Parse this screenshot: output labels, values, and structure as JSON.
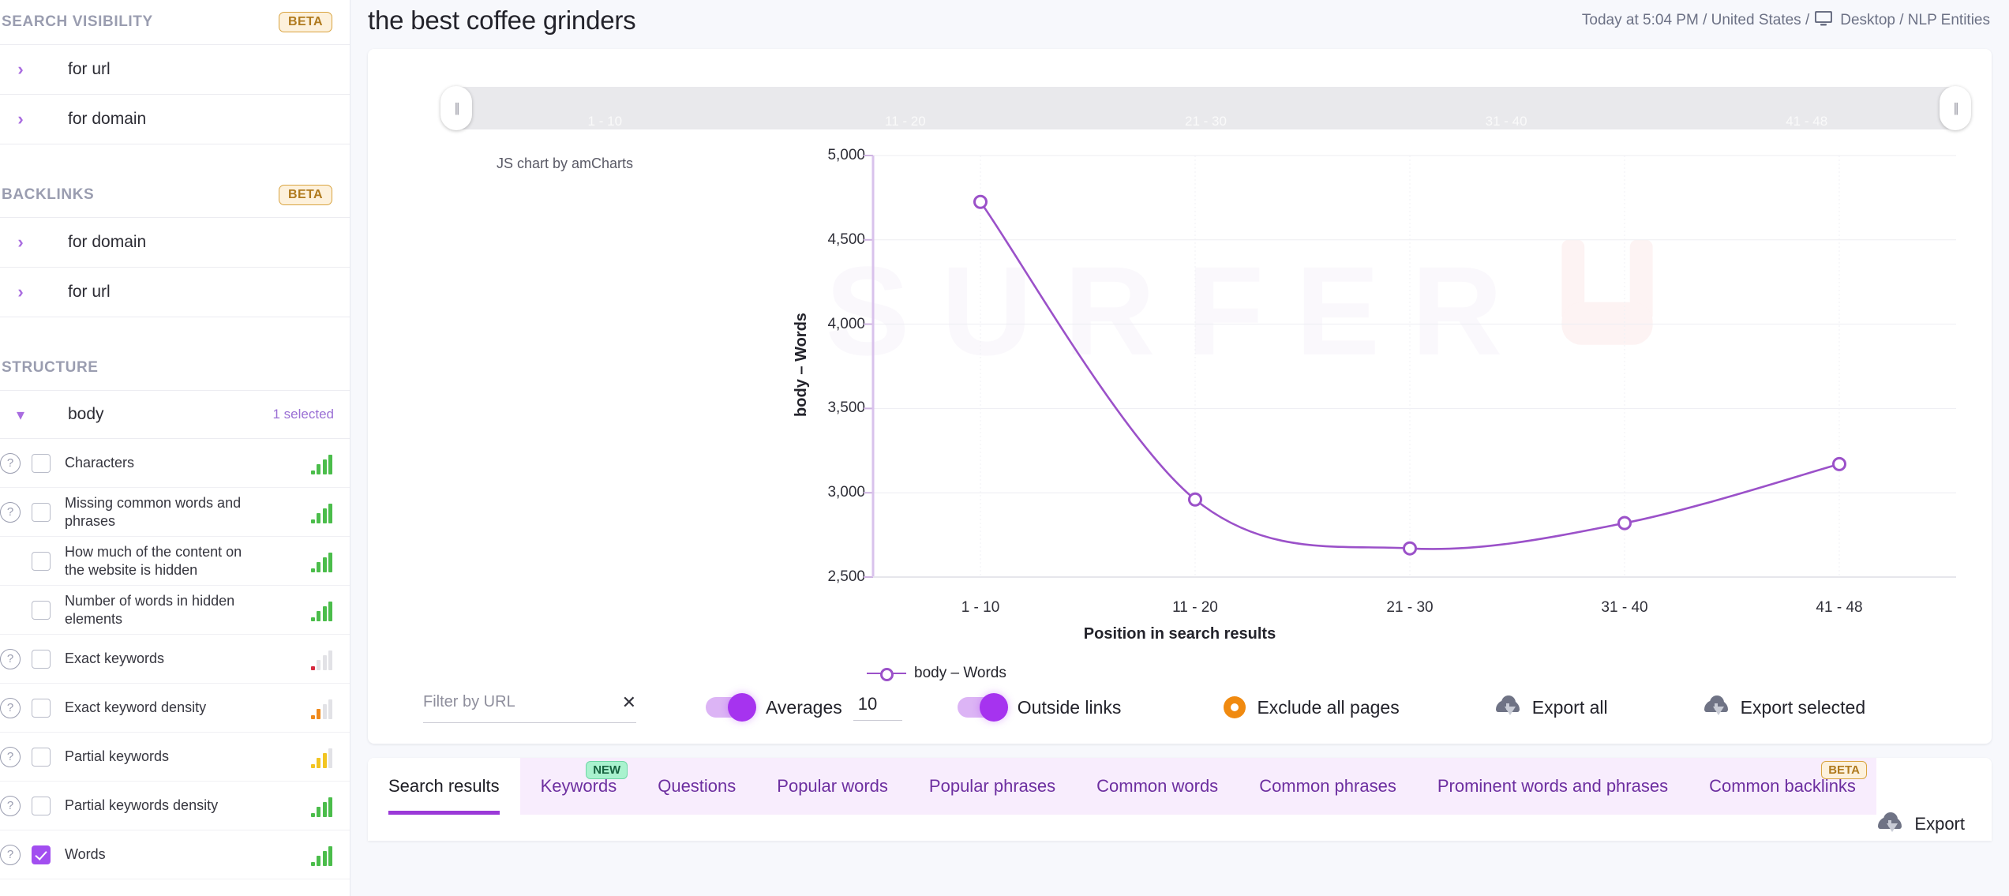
{
  "sidebar": {
    "sections": [
      {
        "title": "SEARCH VISIBILITY",
        "badge": "BETA",
        "rows": [
          {
            "label": "for url"
          },
          {
            "label": "for domain"
          }
        ]
      },
      {
        "title": "BACKLINKS",
        "badge": "BETA",
        "rows": [
          {
            "label": "for domain"
          },
          {
            "label": "for url"
          }
        ]
      }
    ],
    "structure": {
      "title": "STRUCTURE",
      "group": {
        "label": "body",
        "selected_text": "1 selected"
      },
      "items": [
        {
          "label": "Characters",
          "help": true,
          "checked": false,
          "bars": [
            "dot-green",
            "green",
            "green",
            "green"
          ]
        },
        {
          "label": "Missing common words and phrases",
          "help": true,
          "checked": false,
          "bars": [
            "dot-green",
            "green",
            "green",
            "green"
          ]
        },
        {
          "label": "How much of the content on the website is hidden",
          "help": false,
          "checked": false,
          "bars": [
            "dot-green",
            "green",
            "green",
            "green"
          ]
        },
        {
          "label": "Number of words in hidden elements",
          "help": false,
          "checked": false,
          "bars": [
            "dot-green",
            "green",
            "green",
            "green"
          ]
        },
        {
          "label": "Exact keywords",
          "help": true,
          "checked": false,
          "bars": [
            "dot-red",
            "grey",
            "grey",
            "grey"
          ]
        },
        {
          "label": "Exact keyword density",
          "help": true,
          "checked": false,
          "bars": [
            "dot-orange",
            "orange",
            "grey",
            "grey"
          ]
        },
        {
          "label": "Partial keywords",
          "help": true,
          "checked": false,
          "bars": [
            "dot-yellow",
            "yellow",
            "yellow",
            "grey"
          ]
        },
        {
          "label": "Partial keywords density",
          "help": true,
          "checked": false,
          "bars": [
            "dot-green",
            "green",
            "green",
            "green"
          ]
        },
        {
          "label": "Words",
          "help": true,
          "checked": true,
          "bars": [
            "dot-green",
            "green",
            "green",
            "green"
          ]
        }
      ]
    }
  },
  "header": {
    "title": "the best coffee grinders",
    "meta_before": "Today at 5:04 PM / United States /",
    "meta_after": "Desktop / NLP Entities",
    "monitor_icon": "monitor-icon"
  },
  "chart_data": {
    "type": "line",
    "title": "",
    "credit": "JS chart by amCharts",
    "watermark": "SURFER",
    "categories": [
      "1 - 10",
      "11 - 20",
      "21 - 30",
      "31 - 40",
      "41 - 48"
    ],
    "series": [
      {
        "name": "body – Words",
        "values": [
          4725,
          2960,
          2670,
          2820,
          3170
        ],
        "color": "#9b51c9"
      }
    ],
    "xlabel": "Position in search results",
    "ylabel": "body – Words",
    "yticks": [
      5000,
      4500,
      4000,
      3500,
      3000,
      2500
    ],
    "ytick_labels": [
      "5,000",
      "4,500",
      "4,000",
      "3,500",
      "3,000",
      "2,500"
    ],
    "ylim": [
      2500,
      5000
    ],
    "grid": true,
    "legend": [
      {
        "label": "body – Words",
        "color": "#9b51c9"
      }
    ],
    "legend_position": "bottom-left",
    "scrollbar_ticks": [
      "1 - 10",
      "11 - 20",
      "21 - 30",
      "31 - 40",
      "41 - 48"
    ]
  },
  "controls": {
    "filter_placeholder": "Filter by URL",
    "filter_value": "",
    "clear_icon": "close-icon",
    "averages_label": "Averages",
    "averages_value": "10",
    "averages_on": true,
    "outside_links_label": "Outside links",
    "outside_links_on": true,
    "exclude_label": "Exclude all pages",
    "exclude_icon": "eye-icon",
    "export_all_label": "Export all",
    "export_selected_label": "Export selected",
    "cloud_icon": "cloud-download-icon"
  },
  "tabs": {
    "items": [
      {
        "label": "Search results",
        "active": true,
        "badge": ""
      },
      {
        "label": "Keywords",
        "active": false,
        "badge": "NEW"
      },
      {
        "label": "Questions",
        "active": false,
        "badge": ""
      },
      {
        "label": "Popular words",
        "active": false,
        "badge": ""
      },
      {
        "label": "Popular phrases",
        "active": false,
        "badge": ""
      },
      {
        "label": "Common words",
        "active": false,
        "badge": ""
      },
      {
        "label": "Common phrases",
        "active": false,
        "badge": ""
      },
      {
        "label": "Prominent words and phrases",
        "active": false,
        "badge": ""
      },
      {
        "label": "Common backlinks",
        "active": false,
        "badge": "BETA"
      }
    ],
    "export_label": "Export"
  },
  "colors": {
    "accent_purple": "#a633ef",
    "chart_line": "#9b51c9",
    "beta_border": "#d9a441",
    "new_green": "#16623f",
    "orange": "#f08a10"
  }
}
